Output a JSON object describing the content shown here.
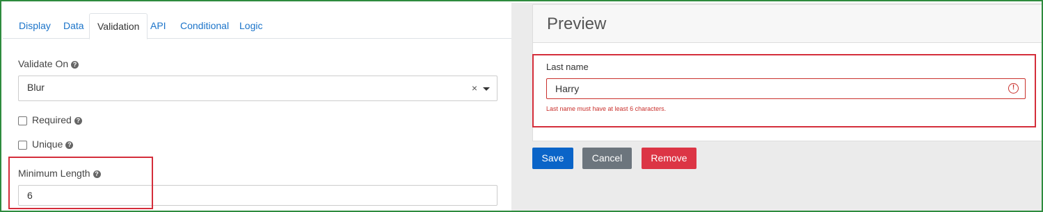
{
  "tabs": [
    {
      "label": "Display"
    },
    {
      "label": "Data"
    },
    {
      "label": "Validation"
    },
    {
      "label": "API"
    },
    {
      "label": "Conditional"
    },
    {
      "label": "Logic"
    }
  ],
  "active_tab": "Validation",
  "validate_on": {
    "label": "Validate On",
    "value": "Blur",
    "clear_glyph": "×"
  },
  "required": {
    "label": "Required",
    "checked": false
  },
  "unique": {
    "label": "Unique",
    "checked": false
  },
  "minimum_length": {
    "label": "Minimum Length",
    "value": "6"
  },
  "preview": {
    "title": "Preview",
    "field_label": "Last name",
    "field_value": "Harry",
    "error_message": "Last name must have at least 6 characters."
  },
  "buttons": {
    "save": "Save",
    "cancel": "Cancel",
    "remove": "Remove"
  },
  "colors": {
    "save": "#0a64c8",
    "cancel": "#6c757d",
    "remove": "#dc3545",
    "highlight": "#d42d3a",
    "link": "#1a73c9"
  }
}
